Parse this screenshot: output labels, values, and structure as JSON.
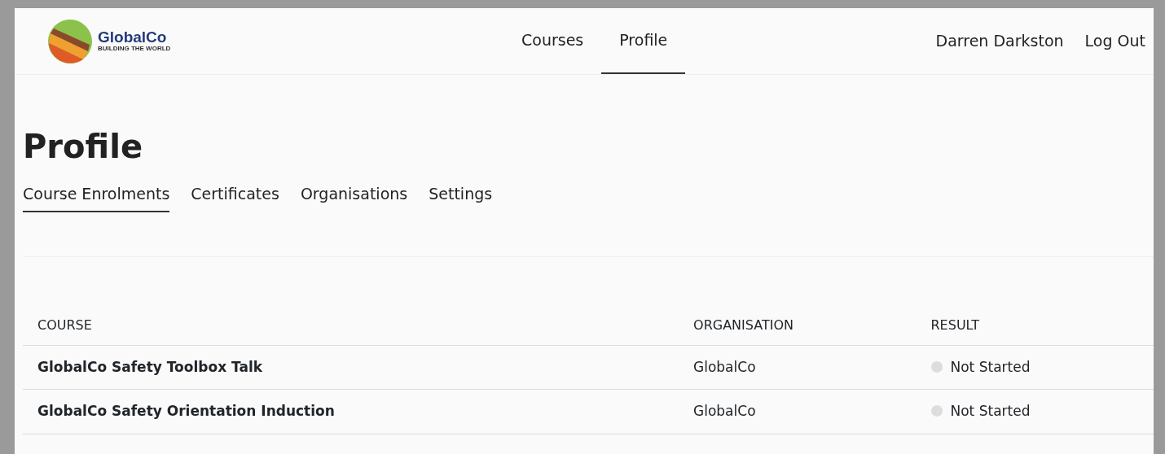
{
  "logo": {
    "name": "GlobalCo",
    "tagline": "BUILDING THE WORLD"
  },
  "nav": [
    {
      "label": "Courses",
      "selected": false
    },
    {
      "label": "Profile",
      "selected": true
    }
  ],
  "user": {
    "name": "Darren Darkston",
    "logout": "Log Out"
  },
  "page_title": "Profile",
  "tabs": [
    {
      "label": "Course Enrolments",
      "selected": true
    },
    {
      "label": "Certificates",
      "selected": false
    },
    {
      "label": "Organisations",
      "selected": false
    },
    {
      "label": "Settings",
      "selected": false
    }
  ],
  "table": {
    "columns": [
      "COURSE",
      "ORGANISATION",
      "RESULT"
    ],
    "rows": [
      {
        "course": "GlobalCo Safety Toolbox Talk",
        "organisation": "GlobalCo",
        "result": "Not Started",
        "color": "#dddddd"
      },
      {
        "course": "GlobalCo Safety Orientation Induction",
        "organisation": "GlobalCo",
        "result": "Not Started",
        "color": "#dddddd"
      }
    ]
  }
}
